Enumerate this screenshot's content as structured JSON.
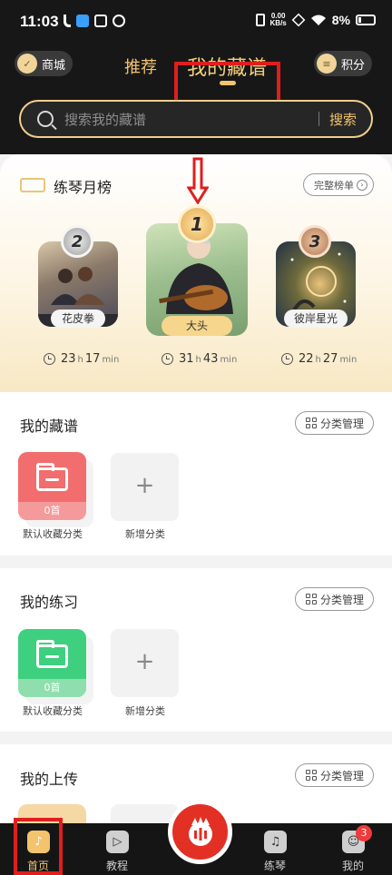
{
  "status_bar": {
    "time": "11:03",
    "speed_value": "0.00",
    "speed_unit": "KB/s",
    "battery": "8%"
  },
  "header": {
    "mall_label": "商城",
    "tabs": [
      {
        "label": "推荐",
        "active": false
      },
      {
        "label": "我的藏谱",
        "active": true
      }
    ],
    "points_label": "积分",
    "search": {
      "placeholder": "搜索我的藏谱",
      "button_label": "搜索"
    }
  },
  "leaderboard": {
    "title": "练琴月榜",
    "full_rank_label": "完整榜单",
    "entries": [
      {
        "rank": "2",
        "name": "花皮拳",
        "hours": "23",
        "minutes": "17"
      },
      {
        "rank": "1",
        "name": "大头",
        "hours": "31",
        "minutes": "43"
      },
      {
        "rank": "3",
        "name": "彼岸星光",
        "hours": "22",
        "minutes": "27"
      }
    ],
    "hour_unit": "h",
    "minute_unit": "min"
  },
  "sections": [
    {
      "title": "我的藏谱",
      "manage_label": "分类管理",
      "folder_count": "0首",
      "folder_label": "默认收藏分类",
      "add_label": "新增分类",
      "folder_color": "#f26d6d"
    },
    {
      "title": "我的练习",
      "manage_label": "分类管理",
      "folder_count": "0首",
      "folder_label": "默认收藏分类",
      "add_label": "新增分类",
      "folder_color": "#3ecf7f"
    },
    {
      "title": "我的上传",
      "manage_label": "分类管理"
    }
  ],
  "bottom_nav": [
    {
      "label": "首页",
      "icon": "music-note-icon",
      "active": true
    },
    {
      "label": "教程",
      "icon": "play-icon"
    },
    {
      "label": "",
      "icon": "center-logo-icon"
    },
    {
      "label": "练琴",
      "icon": "guitar-icon"
    },
    {
      "label": "我的",
      "icon": "user-icon",
      "badge": "3"
    }
  ],
  "colors": {
    "accent_gold": "#f3c46d",
    "dark_bg": "#171717",
    "highlight_red": "#e01e1e",
    "brand_red": "#e33025"
  }
}
